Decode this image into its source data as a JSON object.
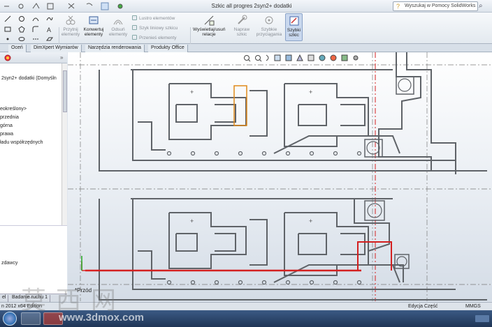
{
  "app": {
    "title": "Szkic all progres 2syn2+ dodatki",
    "help_search_placeholder": "Wyszukaj w Pomocy SolidWorks"
  },
  "ribbon": {
    "trim": "Przytnij elementy",
    "convert": "Konwertuj elementy",
    "offset": "Odsuń elementy",
    "mirror": "Lustro elementów",
    "linear_pattern": "Szyk liniowy szkicu",
    "move": "Przenieś elementy",
    "relations": "Wyświetlaj/usuń relacje",
    "repair": "Napraw szkic",
    "quick_snaps": "Szybkie przyciągania",
    "quick_sketch": "Szybki szkic"
  },
  "tabs": [
    "Oceń",
    "DimXpert Wymiarów",
    "Narzędzia renderowania",
    "Produkty Office"
  ],
  "tree": {
    "root": "2syn2+ dodatki  (Domyśln",
    "items": [
      "eokreślony>",
      "przednia",
      "górna",
      "prawa",
      "ładu współrzędnych"
    ],
    "lower": "zdawcy"
  },
  "viewport": {
    "view_label": "*Przód"
  },
  "bottom_tabs": [
    "el",
    "Badanie ruchu 1"
  ],
  "status": {
    "edition": "n 2012 x64 Edition",
    "editing": "Edycja Część",
    "units": "MMGS"
  },
  "watermark": {
    "chars": "莫西网",
    "url": "www.3dmox.com"
  },
  "colors": {
    "sketch_line": "#5f6368",
    "highlight_red": "#d42020",
    "highlight_orange": "#e08a1a",
    "centerline": "#7a7a7a"
  }
}
